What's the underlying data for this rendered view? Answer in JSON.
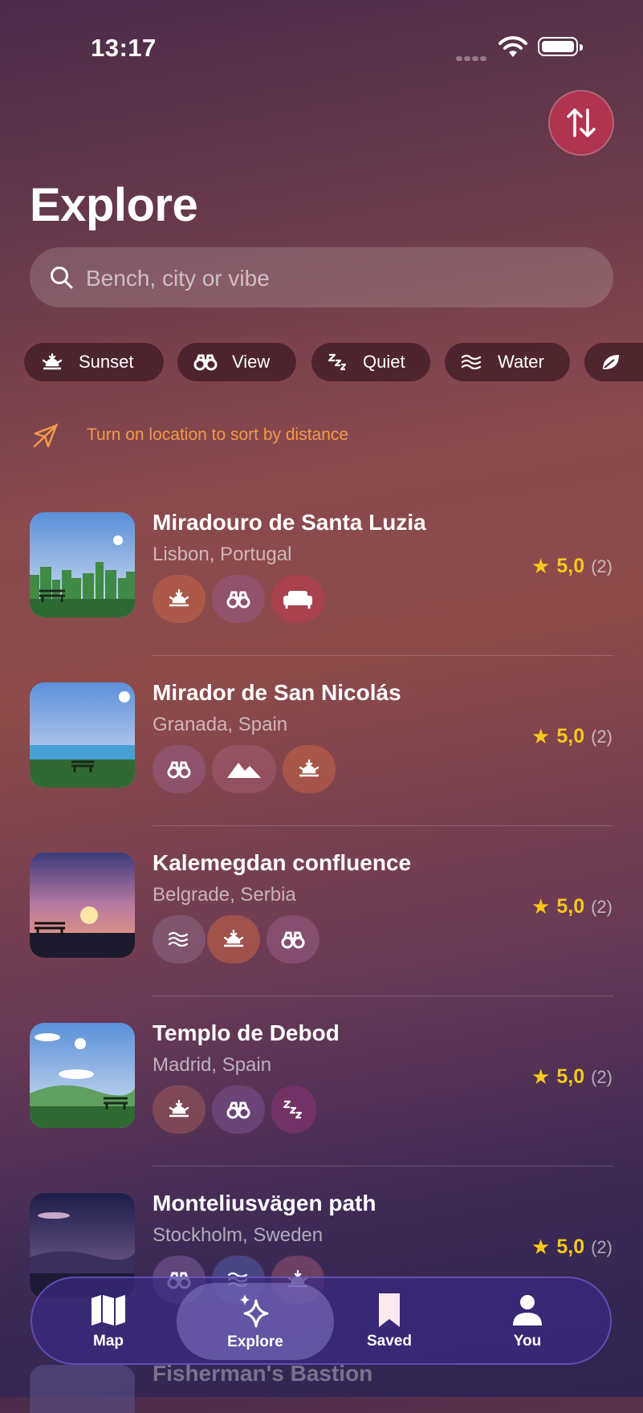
{
  "status": {
    "time": "13:17"
  },
  "page": {
    "title": "Explore"
  },
  "search": {
    "placeholder": "Bench, city or vibe"
  },
  "filters": [
    {
      "label": "Sunset",
      "icon": "sunset-icon"
    },
    {
      "label": "View",
      "icon": "binoculars-icon"
    },
    {
      "label": "Quiet",
      "icon": "zzz-icon"
    },
    {
      "label": "Water",
      "icon": "waves-icon"
    },
    {
      "label": "",
      "icon": "leaf-icon"
    }
  ],
  "location_note": "Turn on location to sort by distance",
  "spots": [
    {
      "name": "Miradouro de Santa Luzia",
      "location": "Lisbon, Portugal",
      "rating": "5,0",
      "count": "(2)",
      "tags": [
        "sunset-icon",
        "binoculars-icon",
        "sofa-icon"
      ]
    },
    {
      "name": "Mirador de San Nicolás",
      "location": "Granada, Spain",
      "rating": "5,0",
      "count": "(2)",
      "tags": [
        "binoculars-icon",
        "mountains-icon",
        "sunset-icon"
      ]
    },
    {
      "name": "Kalemegdan confluence",
      "location": "Belgrade, Serbia",
      "rating": "5,0",
      "count": "(2)",
      "tags": [
        "waves-icon",
        "sunset-icon",
        "binoculars-icon"
      ]
    },
    {
      "name": "Templo de Debod",
      "location": "Madrid, Spain",
      "rating": "5,0",
      "count": "(2)",
      "tags": [
        "sunset-icon",
        "binoculars-icon",
        "zzz-icon"
      ]
    },
    {
      "name": "Monteliusvägen path",
      "location": "Stockholm, Sweden",
      "rating": "5,0",
      "count": "(2)",
      "tags": [
        "binoculars-icon",
        "waves-icon",
        "sunset-icon"
      ]
    }
  ],
  "partial_next": "Fisherman's Bastion",
  "tabs": [
    {
      "label": "Map",
      "icon": "map-icon"
    },
    {
      "label": "Explore",
      "icon": "sparkles-icon",
      "active": true
    },
    {
      "label": "Saved",
      "icon": "bookmark-icon"
    },
    {
      "label": "You",
      "icon": "person-icon"
    }
  ],
  "colors": {
    "accent": "#b0344f",
    "rating": "#f8c81a",
    "notice": "#f4994a",
    "tabbar": "#3a2a82"
  }
}
